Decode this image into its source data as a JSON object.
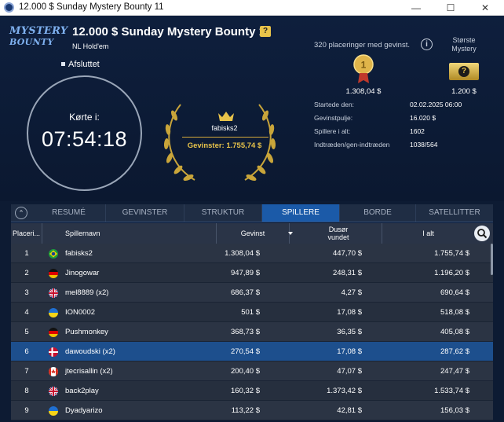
{
  "window": {
    "title": "12.000 $ Sunday Mystery Bounty 11",
    "controls": [
      "—",
      "☐",
      "✕"
    ]
  },
  "header": {
    "logo_line1": "MYSTERY",
    "logo_line2": "BOUNTY",
    "tournament_name": "12.000 $ Sunday Mystery Bounty 11",
    "help_badge": "?",
    "game_type": "NL Hold'em",
    "status": "Afsluttet",
    "clock_label": "Kørte i:",
    "clock_time": "07:54:18"
  },
  "winner": {
    "name": "fabisks2",
    "prize_text": "Gevinster: 1.755,74 $"
  },
  "prizes": {
    "places_text": "320 placeringer med gevinst.",
    "info_icon": "i",
    "first_place_value": "1.308,04 $",
    "medal_number": "1",
    "mystery_label": "Største Mystery",
    "mystery_value": "1.200 $",
    "mystery_icon": "?"
  },
  "info": [
    {
      "key": "Startede den:",
      "value": "02.02.2025   06:00"
    },
    {
      "key": "Gevinstpulje:",
      "value": "16.020 $"
    },
    {
      "key": "Spillere i alt:",
      "value": "1602"
    },
    {
      "key": "Indtræden/gen-indtræden",
      "value": "1038/564"
    }
  ],
  "tabs": {
    "collapse_icon": "⌃",
    "items": [
      {
        "label": "RESUMÉ"
      },
      {
        "label": "GEVINSTER"
      },
      {
        "label": "STRUKTUR"
      },
      {
        "label": "SPILLERE"
      },
      {
        "label": "BORDE"
      },
      {
        "label": "SATELLITTER"
      }
    ],
    "active": "SPILLERE"
  },
  "table": {
    "headers": {
      "place": "Placeri...",
      "name": "Spillernavn",
      "prize": "Gevinst",
      "bounty_1": "Dusør",
      "bounty_2": "vundet",
      "total": "I alt"
    },
    "rows": [
      {
        "place": "1",
        "flag": "brazil",
        "name": "fabisks2",
        "prize": "1.308,04 $",
        "bounty": "447,70 $",
        "total": "1.755,74 $"
      },
      {
        "place": "2",
        "flag": "germany",
        "name": "Jinogowar",
        "prize": "947,89 $",
        "bounty": "248,31 $",
        "total": "1.196,20 $"
      },
      {
        "place": "3",
        "flag": "uk",
        "name": "mel8889 (x2)",
        "prize": "686,37 $",
        "bounty": "4,27 $",
        "total": "690,64 $"
      },
      {
        "place": "4",
        "flag": "ukraine",
        "name": "ION0002",
        "prize": "501 $",
        "bounty": "17,08 $",
        "total": "518,08 $"
      },
      {
        "place": "5",
        "flag": "germany",
        "name": "Pushmonkey",
        "prize": "368,73 $",
        "bounty": "36,35 $",
        "total": "405,08 $"
      },
      {
        "place": "6",
        "flag": "denmark",
        "name": "dawoudski (x2)",
        "prize": "270,54 $",
        "bounty": "17,08 $",
        "total": "287,62 $"
      },
      {
        "place": "7",
        "flag": "canada",
        "name": "jtecrisallin (x2)",
        "prize": "200,40 $",
        "bounty": "47,07 $",
        "total": "247,47 $"
      },
      {
        "place": "8",
        "flag": "uk",
        "name": "back2play",
        "prize": "160,32 $",
        "bounty": "1.373,42 $",
        "total": "1.533,74 $"
      },
      {
        "place": "9",
        "flag": "ukraine",
        "name": "Dyadyarizo",
        "prize": "113,22 $",
        "bounty": "42,81 $",
        "total": "156,03 $"
      }
    ],
    "selected_index": 5
  }
}
